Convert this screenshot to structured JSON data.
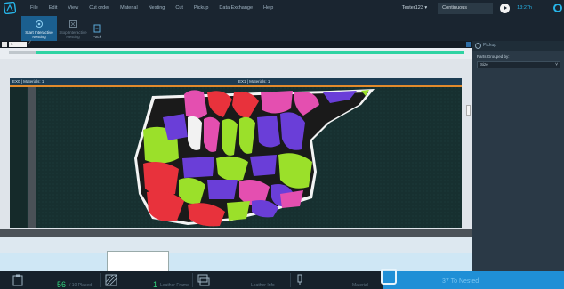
{
  "menubar": {
    "items": [
      "File",
      "Edit",
      "View",
      "Cut order",
      "Material",
      "Nesting",
      "Cut",
      "Pickup",
      "Data Exchange",
      "Help"
    ],
    "user": "Tester123",
    "user_chevron": "▾",
    "mode": "Continuous",
    "timer": "13:27h",
    "logo_icon": "app-logo-icon",
    "play_icon": "play-icon"
  },
  "ribbon": {
    "start_nesting": "Start Interactive\nNesting",
    "stop_nesting": "Stop Interactive\nNesting",
    "pack": "Pack"
  },
  "canvas": {
    "tab_value": "1",
    "sheet_left_label": "EX0 | Materials: 1",
    "sheet_right_label": "EX1 | Materials: 1",
    "progress_fraction": 0.98,
    "colors": {
      "accent": "#1f8fd6",
      "progress": "#2fd3a3",
      "border": "#e28a2c",
      "sheet": "#152a2a",
      "piece_red": "#e8323c",
      "piece_magenta": "#e44fb0",
      "piece_purple": "#6a3ed8",
      "piece_green": "#9be02a",
      "piece_white": "#f2f2f2"
    }
  },
  "right_panel": {
    "title": "Pickup",
    "group_label": "Parts Grouped by:",
    "group_value": "Size"
  },
  "statusbar": {
    "items": [
      {
        "icon": "clipboard-icon",
        "value": "56",
        "label": "/ 10 Placed"
      },
      {
        "icon": "hatch-pattern-icon",
        "value": "1",
        "label": "Leather Frame"
      },
      {
        "icon": "layers-icon",
        "value": "",
        "label": "Leather Info"
      },
      {
        "icon": "pen-icon",
        "value": "",
        "label": "Material"
      },
      {
        "icon": "nesting-icon",
        "value": "",
        "label": "37 To Nested"
      }
    ]
  }
}
